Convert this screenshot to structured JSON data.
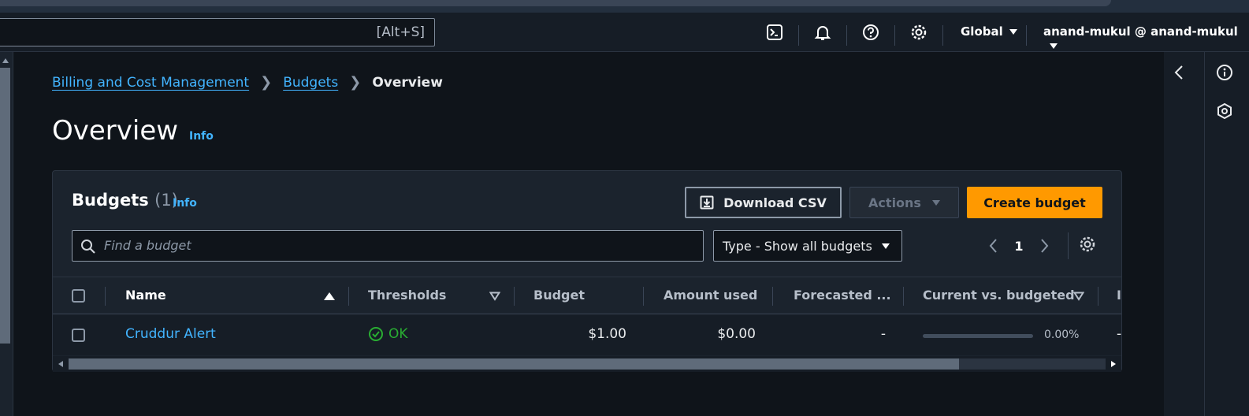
{
  "nav": {
    "search_shortcut": "[Alt+S]",
    "region": "Global",
    "account": "anand-mukul @ anand-mukul",
    "icons": [
      "cloudshell-icon",
      "bell-icon",
      "help-icon",
      "gear-icon"
    ]
  },
  "breadcrumb": {
    "items": [
      "Billing and Cost Management",
      "Budgets"
    ],
    "current": "Overview"
  },
  "page": {
    "title": "Overview",
    "info": "Info"
  },
  "budgets": {
    "title": "Budgets",
    "count": "(1)",
    "info": "Info",
    "download_label": "Download CSV",
    "actions_label": "Actions",
    "create_label": "Create budget",
    "filter_placeholder": "Find a budget",
    "type_filter": "Type - Show all budgets",
    "page_number": "1",
    "columns": [
      "Name",
      "Thresholds",
      "Budget",
      "Amount used",
      "Forecasted ...",
      "Current vs. budgeted"
    ],
    "rows": [
      {
        "name": "Cruddur Alert",
        "threshold": "OK",
        "budget": "$1.00",
        "amount_used": "$0.00",
        "forecasted": "-",
        "current_vs_budgeted": "0.00%",
        "current_vs_budgeted_fraction": 0
      }
    ]
  },
  "colors": {
    "accent_link": "#42b4ff",
    "primary_button": "#ff9900",
    "status_ok": "#29ad32",
    "background": "#0f141a"
  }
}
